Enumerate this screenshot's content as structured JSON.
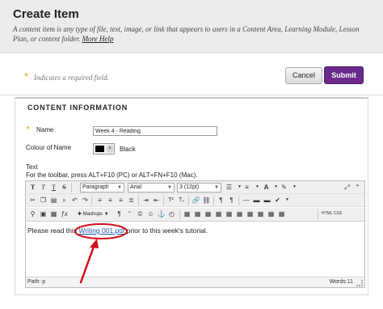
{
  "header": {
    "title": "Create Item",
    "description": "A content item is any type of file, text, image, or link that appears to users in a Content Area, Learning Module, Lesson Plan, or content folder.",
    "more_help": "More Help"
  },
  "required_note": {
    "symbol": "*",
    "text": "Indicates a required field."
  },
  "actions": {
    "cancel_label": "Cancel",
    "submit_label": "Submit"
  },
  "section": {
    "title": "CONTENT INFORMATION"
  },
  "form": {
    "name_label": "Name",
    "name_value": "Week 4 - Reading",
    "colour_label": "Colour of Name",
    "colour_value": "Black",
    "text_label": "Text",
    "toolbar_hint": "For the toolbar, press ALT+F10 (PC) or ALT+FN+F10 (Mac)."
  },
  "toolbar": {
    "paragraph": "Paragraph",
    "font": "Arial",
    "size": "3 (12pt)",
    "mashups": "Mashups",
    "html_label": "HTML CSS"
  },
  "editor": {
    "text_before": "Please read this ",
    "link_text": "Writing 001.pdf",
    "text_after": " prior to this week's tutorial.",
    "path": "Path: p",
    "words": "Words:11"
  },
  "colors": {
    "accent": "#6a2a8a",
    "required_star": "#f0a030",
    "annotation": "#d0101a",
    "link": "#1a5aaa"
  }
}
